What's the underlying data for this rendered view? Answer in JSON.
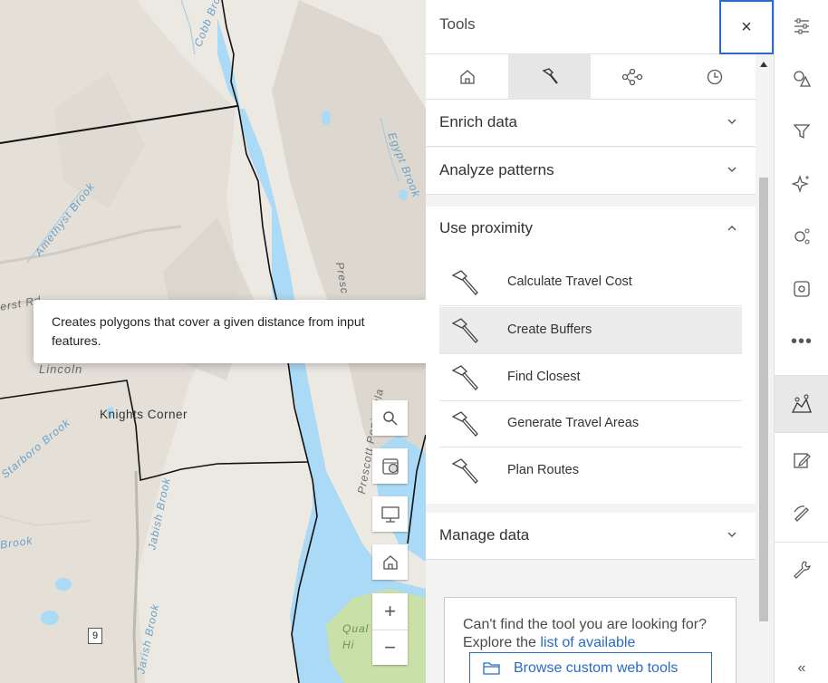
{
  "map": {
    "labels": {
      "cobb_brook": "Cobb Brook",
      "amethyst_brook": "Amethyst Brook",
      "egypt_brook": "Egypt Brook",
      "prescott": "Presc",
      "prescott_peninsula": "Prescott Peninsula",
      "erst_rd": "erst Rd",
      "lincoln": "Lincoln",
      "knights_corner": "Knights Corner",
      "starboro_brook": "Starboro Brook",
      "brook": "Brook",
      "jabish_brook": "Jabish Brook",
      "jarish_brook": "Jarish Brook",
      "qual_hi": "Qual Hi",
      "road_number": "9"
    },
    "tooltip": "Creates polygons that cover a given distance from input features.",
    "buttons": {
      "search": "search-icon",
      "basemap": "basemap-icon",
      "present": "monitor-icon",
      "home": "home-icon",
      "zoom_in": "+",
      "zoom_out": "−"
    }
  },
  "panel": {
    "title": "Tools",
    "close": "×",
    "tabs": [
      {
        "icon": "home-icon",
        "active": false
      },
      {
        "icon": "hammer-icon",
        "active": true
      },
      {
        "icon": "branch-icon",
        "active": false
      },
      {
        "icon": "history-icon",
        "active": false
      }
    ],
    "sections": {
      "enrich": "Enrich data",
      "analyze": "Analyze patterns",
      "proximity": "Use proximity",
      "manage": "Manage data"
    },
    "proximity_tools": [
      "Calculate Travel Cost",
      "Create Buffers",
      "Find Closest",
      "Generate Travel Areas",
      "Plan Routes"
    ],
    "help": {
      "text": "Can't find the tool you are looking for? Explore the ",
      "link": "list of available",
      "browse": "Browse custom web tools"
    }
  },
  "action_bar": {
    "items": [
      "sliders-icon",
      "shapes-icon",
      "filter-icon",
      "sparkle-icon",
      "cluster-icon",
      "settings-icon",
      "more-icon",
      "analysis-icon",
      "edit-icon",
      "sketch-icon",
      "wrench-icon"
    ],
    "collapse": "«"
  },
  "colors": {
    "accent": "#2a6cc4",
    "water": "#aadaf5",
    "park": "#c9e0a8"
  }
}
